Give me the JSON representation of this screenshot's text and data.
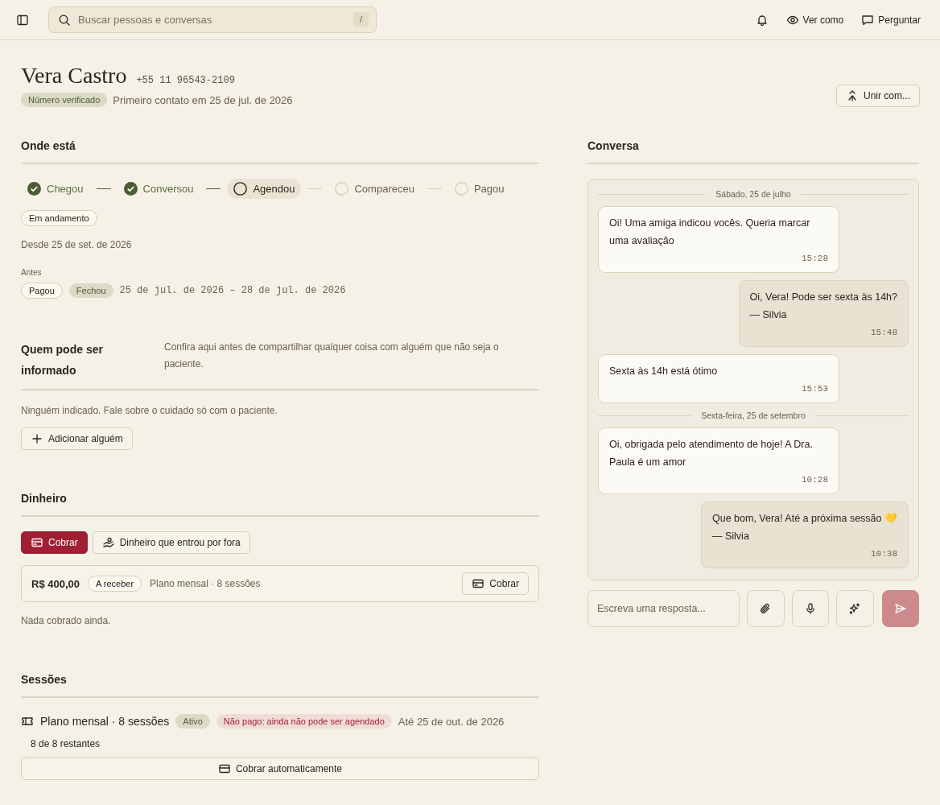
{
  "top_bar": {
    "search": {
      "placeholder": "Buscar pessoas e conversas",
      "shortcut": "/"
    },
    "actions": [
      {
        "label": "Ver como",
        "kind": "eye"
      },
      {
        "label": "Perguntar",
        "kind": "chat"
      }
    ]
  },
  "header": {
    "name": "Vera Castro",
    "phone": "+55 11 96543-2109",
    "badge": "Número verificado",
    "first_contact": "Primeiro contato em 25 de jul. de 2026",
    "merge_button": "Unir com..."
  },
  "onde_esta": {
    "title": "Onde está",
    "steps": [
      {
        "label": "Chegou",
        "done": true,
        "selected": false
      },
      {
        "label": "Conversou",
        "done": true,
        "selected": false
      },
      {
        "label": "Agendou",
        "done": false,
        "selected": true
      },
      {
        "label": "Compareceu",
        "done": false,
        "selected": false
      },
      {
        "label": "Pagou",
        "done": false,
        "selected": false
      }
    ],
    "status_badge": "Em andamento",
    "since": "Desde 25 de set. de 2026",
    "history_label": "Antes",
    "history_tags": [
      {
        "label": "Pagou",
        "kind": "outline"
      },
      {
        "label": "Fechou",
        "kind": "filled"
      }
    ],
    "history_range": "25 de jul. de 2026 – 28 de jul. de 2026"
  },
  "informado": {
    "title": "Quem pode ser informado",
    "description": "Confira aqui antes de compartilhar qualquer coisa com alguém que não seja o paciente.",
    "empty": "Ninguém indicado. Fale sobre o cuidado só com o paciente.",
    "add_button": "Adicionar alguém"
  },
  "dinheiro": {
    "title": "Dinheiro",
    "buttons": [
      {
        "label": "Cobrar",
        "kind": "primary"
      },
      {
        "label": "Dinheiro que entrou por fora",
        "kind": "secondary"
      }
    ],
    "charge": {
      "amount": "R$ 400,00",
      "tag": "A receber",
      "description": "Plano mensal · 8 sessões",
      "button": "Cobrar"
    },
    "note": "Nada cobrado ainda."
  },
  "sessoes": {
    "title": "Sessões",
    "plan": {
      "name": "Plano mensal · 8 sessões",
      "tags": [
        {
          "label": "Ativo",
          "kind": "ok"
        },
        {
          "label": "Não pago: ainda não pode ser agendado",
          "kind": "warn"
        }
      ],
      "until": "Até 25 de out. de 2026",
      "remaining": "8 de 8 restantes",
      "auto_button": "Cobrar automaticamente"
    }
  },
  "conversa": {
    "title": "Conversa",
    "days": [
      {
        "date": "Sábado, 25 de julho",
        "messages": [
          {
            "text": "Oi! Uma amiga indicou vocês. Queria marcar uma avaliação",
            "time": "15:28",
            "outgoing": false
          },
          {
            "text": "Oi, Vera! Pode ser sexta às 14h?\n— Silvia",
            "time": "15:48",
            "outgoing": true
          },
          {
            "text": "Sexta às 14h está ótimo",
            "time": "15:53",
            "outgoing": false
          }
        ]
      },
      {
        "date": "Sexta-feira, 25 de setembro",
        "messages": [
          {
            "text": "Oi, obrigada pelo atendimento de hoje! A Dra. Paula é um amor",
            "time": "10:28",
            "outgoing": false
          },
          {
            "text": "Que bom, Vera! Até a próxima sessão 💛\n— Silvia",
            "time": "10:38",
            "outgoing": true
          }
        ]
      }
    ],
    "composer": {
      "placeholder": "Escreva uma resposta...",
      "send_disabled": true
    }
  }
}
